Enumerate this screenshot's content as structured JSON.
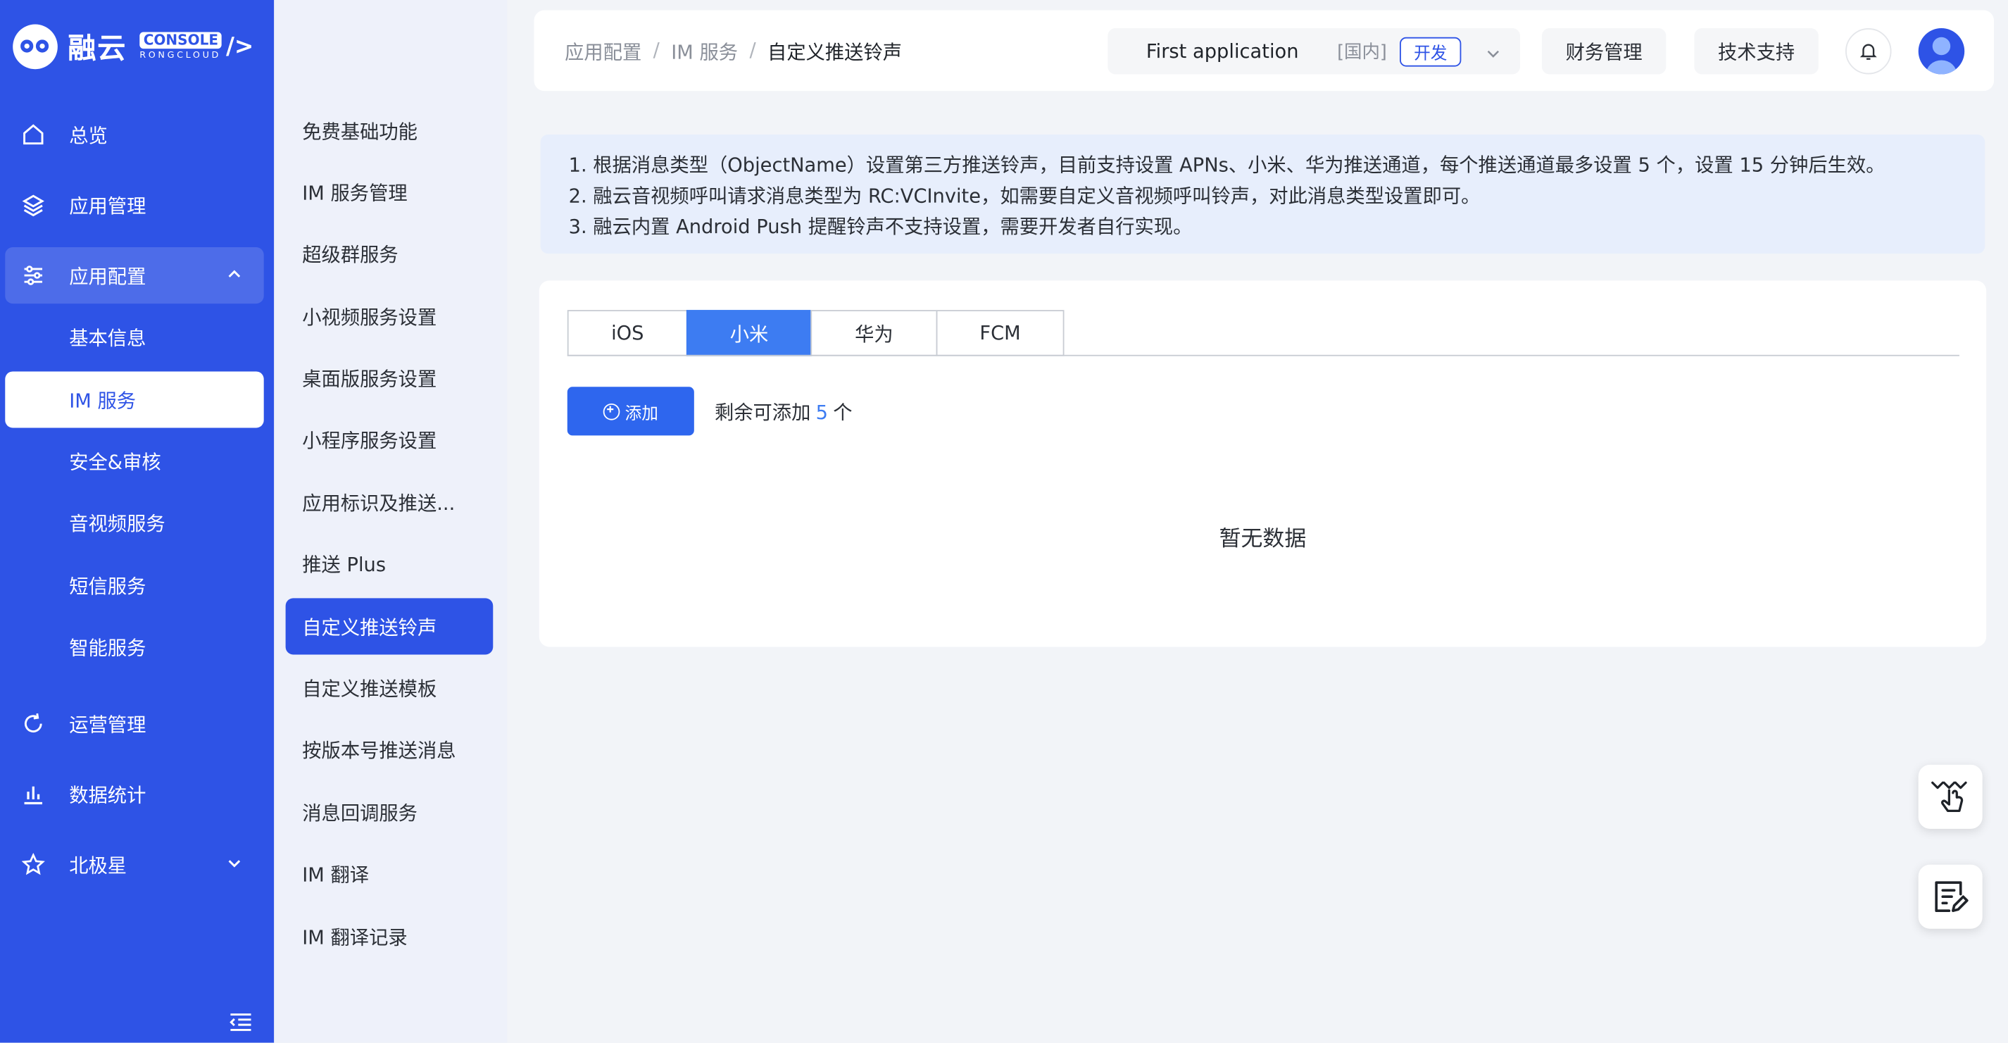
{
  "logo": {
    "name": "融云",
    "console": "CONSOLE",
    "sub": "RONGCLOUD",
    "slash": "/>"
  },
  "sidebar": {
    "items": [
      {
        "label": "总览",
        "icon": "home-icon"
      },
      {
        "label": "应用管理",
        "icon": "layers-icon"
      },
      {
        "label": "应用配置",
        "icon": "sliders-icon"
      },
      {
        "label": "运营管理",
        "icon": "refresh-icon"
      },
      {
        "label": "数据统计",
        "icon": "bar-chart-icon"
      },
      {
        "label": "北极星",
        "icon": "star-icon"
      }
    ],
    "sub_items": [
      "基本信息",
      "IM 服务",
      "安全&审核",
      "音视频服务",
      "短信服务",
      "智能服务"
    ]
  },
  "submenu": {
    "items": [
      "免费基础功能",
      "IM 服务管理",
      "超级群服务",
      "小视频服务设置",
      "桌面版服务设置",
      "小程序服务设置",
      "应用标识及推送...",
      "推送 Plus",
      "自定义推送铃声",
      "自定义推送模板",
      "按版本号推送消息",
      "消息回调服务",
      "IM 翻译",
      "IM 翻译记录"
    ]
  },
  "header": {
    "breadcrumb": [
      "应用配置",
      "IM 服务",
      "自定义推送铃声"
    ],
    "app_name": "First application",
    "app_region": "[国内]",
    "app_env": "开发",
    "finance": "财务管理",
    "support": "技术支持"
  },
  "notice": {
    "lines": [
      "1.  根据消息类型（ObjectName）设置第三方推送铃声，目前支持设置 APNs、小米、华为推送通道，每个推送通道最多设置 5 个，设置 15 分钟后生效。",
      "2.  融云音视频呼叫请求消息类型为 RC:VCInvite，如需要自定义音视频呼叫铃声，对此消息类型设置即可。",
      "3.  融云内置 Android Push 提醒铃声不支持设置，需要开发者自行实现。"
    ]
  },
  "content": {
    "tabs": [
      "iOS",
      "小米",
      "华为",
      "FCM"
    ],
    "active_tab": "小米",
    "add_label": "添加",
    "remain_prefix": "剩余可添加",
    "remain_count": "5",
    "remain_suffix": "个",
    "empty_text": "暂无数据"
  },
  "colors": {
    "brand": "#2e53e6",
    "accent": "#3d7cf2",
    "notice_bg": "#e7eefc"
  }
}
